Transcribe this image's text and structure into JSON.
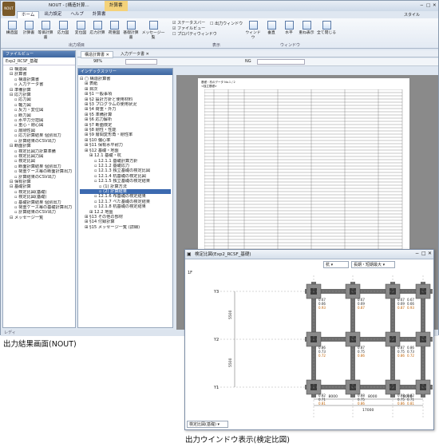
{
  "app": {
    "title": "NOUT - [構造計算...",
    "logo_text": "NOUT",
    "ribbon_tab_context": "計算書",
    "ribbon_tabs": [
      "ホーム",
      "出力設定",
      "ヘルプ",
      "計算書"
    ],
    "style_label": "スタイル"
  },
  "ribbon": {
    "buttons": [
      "構造図",
      "計算書",
      "等価計算書",
      "応力図",
      "変位図",
      "応力計算",
      "荷重図",
      "基礎計算書",
      "メッセージ一覧"
    ],
    "group_output": "出力項目",
    "checks": [
      "ステータスバー",
      "ファイルビュー",
      "プロパティウィンドウ",
      "出力ウィンドウ"
    ],
    "group_view": "表示",
    "window_buttons": [
      "ウィンドウ",
      "垂直",
      "水平",
      "重ね表示",
      "全て閉じる"
    ],
    "group_window": "ウィンドウ"
  },
  "left_panel": {
    "title": "ファイルビュー",
    "file": "Exp2_RCSF_基礎",
    "items": [
      {
        "label": "構造図",
        "level": 1
      },
      {
        "label": "計算書",
        "level": 1
      },
      {
        "label": "構造計算書",
        "level": 2
      },
      {
        "label": "入力データ書",
        "level": 2
      },
      {
        "label": "準備計算",
        "level": 1
      },
      {
        "label": "応力計算",
        "level": 1
      },
      {
        "label": "応力図",
        "level": 2
      },
      {
        "label": "軸力図",
        "level": 2
      },
      {
        "label": "反力・変位図",
        "level": 2
      },
      {
        "label": "断力図",
        "level": 2
      },
      {
        "label": "水平力分担図",
        "level": 2
      },
      {
        "label": "重心・剛心図",
        "level": 2
      },
      {
        "label": "層剛性図",
        "level": 2
      },
      {
        "label": "応力計算結果 個別出力",
        "level": 2
      },
      {
        "label": "計算結果のCSV出力",
        "level": 2
      },
      {
        "label": "断面計算",
        "level": 1
      },
      {
        "label": "検定比図力計算準備",
        "level": 2
      },
      {
        "label": "検定比図力図",
        "level": 2
      },
      {
        "label": "検定比図",
        "level": 2
      },
      {
        "label": "断面計算結果 個別出力",
        "level": 2
      },
      {
        "label": "荷重ケース毎の断面計算出力",
        "level": 2
      },
      {
        "label": "計算結果のCSV出力",
        "level": 2
      },
      {
        "label": "保有計算",
        "level": 1
      },
      {
        "label": "基礎計算",
        "level": 1
      },
      {
        "label": "検定比図(基礎)",
        "level": 2
      },
      {
        "label": "検定比図(基礎)",
        "level": 2
      },
      {
        "label": "基礎計算結果 個別出力",
        "level": 2
      },
      {
        "label": "荷重ケース毎の基礎計算出力",
        "level": 2
      },
      {
        "label": "計算結果のCSV出力",
        "level": 2
      },
      {
        "label": "メッセージ一覧",
        "level": 1
      }
    ],
    "status": "レディ"
  },
  "index_panel": {
    "title": "インデックスツリー",
    "root": "構造計算書",
    "items": [
      {
        "label": "表紙",
        "level": 1
      },
      {
        "label": "目次",
        "level": 1
      },
      {
        "label": "§1 一般事項",
        "level": 1
      },
      {
        "label": "§2 設計方針と使用材料",
        "level": 1
      },
      {
        "label": "§3 プログラムの使用状況",
        "level": 1
      },
      {
        "label": "§4 荷重・外力",
        "level": 1
      },
      {
        "label": "§5 準備計算",
        "level": 1
      },
      {
        "label": "§6 応力解析",
        "level": 1
      },
      {
        "label": "§7 断面検定",
        "level": 1
      },
      {
        "label": "§8 剛性・性能",
        "level": 1
      },
      {
        "label": "§9 層間変形角・剛性率",
        "level": 1
      },
      {
        "label": "§10 偏心率",
        "level": 1
      },
      {
        "label": "§11 保有水平耐力",
        "level": 1
      },
      {
        "label": "§12 基礎・地盤",
        "level": 1
      },
      {
        "label": "12.1 基礎・杭",
        "level": 2
      },
      {
        "label": "12.1.1 基礎計算方針",
        "level": 3
      },
      {
        "label": "12.1.2 基礎応力",
        "level": 3
      },
      {
        "label": "12.1.3 独立基礎の検定比図",
        "level": 3
      },
      {
        "label": "12.1.4 杭基礎の検定比図",
        "level": 3
      },
      {
        "label": "12.1.5 独立基礎の検定結果",
        "level": 3
      },
      {
        "label": "(1) 計算方法",
        "level": 4
      },
      {
        "label": "(2) 計算結果",
        "level": 4
      },
      {
        "label": "12.1.6 布基礎の検定結果",
        "level": 3
      },
      {
        "label": "12.1.7 べた基礎の検定結果",
        "level": 3
      },
      {
        "label": "12.1.8 杭基礎の検定結果",
        "level": 3
      },
      {
        "label": "12.2 地盤",
        "level": 2
      },
      {
        "label": "§13 その他の部材",
        "level": 1
      },
      {
        "label": "§14 付録計算",
        "level": 1
      },
      {
        "label": "§15 メッセージ一覧 (詳細)",
        "level": 1
      }
    ]
  },
  "doc_tabs": [
    "構造計算書",
    "入力データ書"
  ],
  "zoom": "98%",
  "ng_label": "NG",
  "sheet": {
    "header_left": "基礎・杭のデータ No.1 / 2",
    "title": "<独立基礎>",
    "section": "12.1.5 独立基礎の検定結果"
  },
  "sub_window": {
    "title": "検定比図(Exp2_RCSF_基礎)",
    "select1": "杭",
    "select2": "長期・短期最大",
    "footer_select": "検定比図(基礎)",
    "y_labels": [
      "Y3",
      "Y2",
      "Y1"
    ],
    "x_labels": [
      "X1",
      "X2",
      "X3",
      "X4"
    ],
    "dims_x": [
      "8000",
      "8000",
      "8000"
    ],
    "dim_total": "17000",
    "dims_y": [
      "5500",
      "5500"
    ],
    "floor": "1F",
    "ratios": {
      "top_row": [
        [
          "0.67",
          "0.66",
          "0.93"
        ],
        [
          "0.67",
          "0.69",
          "0.87"
        ],
        [
          "0.67",
          "0.69",
          "0.87"
        ],
        [
          "0.67",
          "0.66",
          "0.93"
        ]
      ],
      "mid_row": [
        [
          "0.86",
          "0.73",
          "0.72"
        ],
        [
          "0.87",
          "0.75",
          "0.86"
        ],
        [
          "0.87",
          "0.75",
          "0.86"
        ],
        [
          "0.86",
          "0.73",
          "0.72"
        ]
      ],
      "bot_row": [
        [
          "0.82",
          "0.71",
          "0.81"
        ],
        [
          "0.88",
          "0.75",
          "0.86"
        ],
        [
          "0.88",
          "0.75",
          "0.86"
        ],
        [
          "0.82",
          "0.71",
          "0.81"
        ]
      ]
    }
  },
  "captions": {
    "left": "出力結果画面(NOUT)",
    "right": "出力ウインドウ表示(検定比図)"
  }
}
